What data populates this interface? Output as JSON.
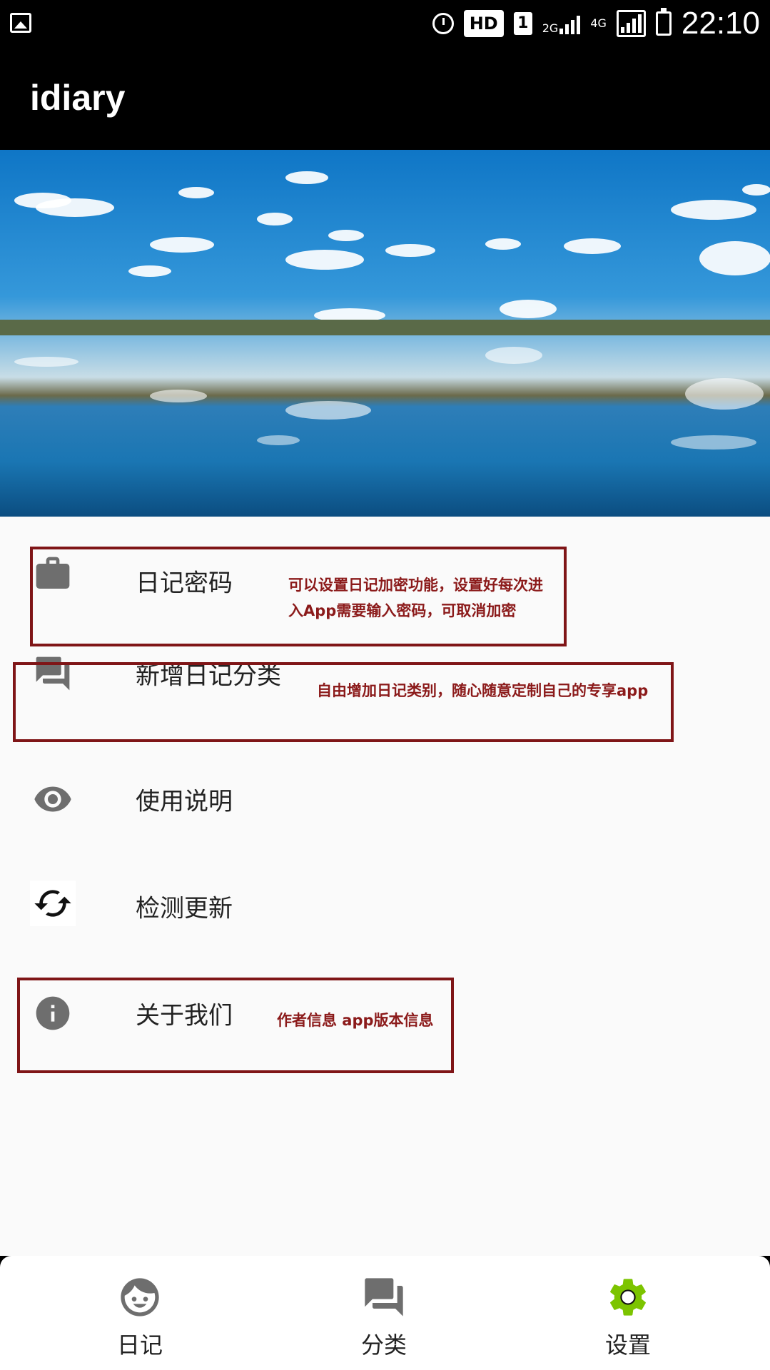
{
  "status_bar": {
    "hd": "HD",
    "sim": "1",
    "net_2g": "2G",
    "net_4g": "4G",
    "time": "22:10"
  },
  "app": {
    "title": "idiary"
  },
  "menu": {
    "items": [
      {
        "label": "日记密码",
        "icon": "briefcase-icon"
      },
      {
        "label": "新增日记分类",
        "icon": "forum-icon"
      },
      {
        "label": "使用说明",
        "icon": "eye-icon"
      },
      {
        "label": "检测更新",
        "icon": "sync-icon"
      },
      {
        "label": "关于我们",
        "icon": "info-icon"
      }
    ]
  },
  "annotations": {
    "password_line1": "可以设置日记加密功能，设置好每次进",
    "password_line2": "入App需要输入密码，可取消加密",
    "category": "自由增加日记类别，随心随意定制自己的专享app",
    "about": "作者信息 app版本信息"
  },
  "bottom_nav": {
    "items": [
      {
        "label": "日记",
        "icon": "face-icon"
      },
      {
        "label": "分类",
        "icon": "forum-icon"
      },
      {
        "label": "设置",
        "icon": "gear-icon"
      }
    ],
    "active_index": 2
  },
  "colors": {
    "annotation": "#8b1a1a",
    "active_nav": "#7cc400",
    "icon_gray": "#6e6e6e"
  }
}
